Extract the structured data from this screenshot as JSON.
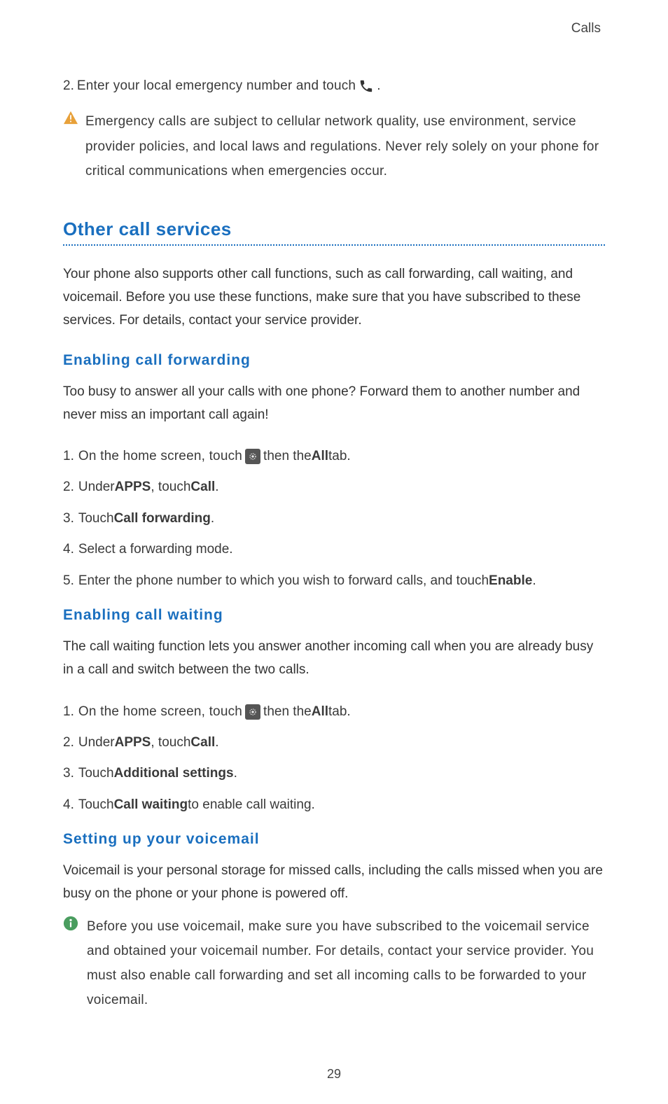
{
  "header": "Calls",
  "emergency": {
    "step_num": "2.",
    "step_text_before": "Enter your local emergency number and touch",
    "step_text_after": ".",
    "warning_text": "Emergency calls are subject to cellular network quality, use environment, service provider policies, and local laws and regulations. Never rely solely on your phone for critical communications when emergencies occur."
  },
  "section_heading": "Other call services",
  "intro_para": "Your phone also supports other call functions, such as call forwarding, call waiting, and voicemail. Before you use these functions, make sure that you have subscribed to these services. For details, contact your service provider.",
  "forwarding": {
    "heading": "Enabling call forwarding",
    "intro": "Too busy to answer all your calls with one phone? Forward them to another number and never miss an important call again!",
    "steps": {
      "s1_num": "1.",
      "s1_before": "On the home screen, touch",
      "s1_mid": "then the ",
      "s1_bold": "All",
      "s1_after": " tab.",
      "s2_num": "2.",
      "s2_before": "Under ",
      "s2_bold1": "APPS",
      "s2_mid": ", touch ",
      "s2_bold2": "Call",
      "s2_after": ".",
      "s3_num": "3.",
      "s3_before": "Touch ",
      "s3_bold": "Call forwarding",
      "s3_after": ".",
      "s4_num": "4.",
      "s4_text": "Select a forwarding mode.",
      "s5_num": "5.",
      "s5_before": "Enter the phone number to which you wish to forward calls, and touch ",
      "s5_bold": "Enable",
      "s5_after": "."
    }
  },
  "waiting": {
    "heading": "Enabling call waiting",
    "intro": "The call waiting function lets you answer another incoming call when you are already busy in a call and switch between the two calls.",
    "steps": {
      "s1_num": "1.",
      "s1_before": "On the home screen, touch",
      "s1_mid": "then the ",
      "s1_bold": "All",
      "s1_after": " tab.",
      "s2_num": "2.",
      "s2_before": "Under ",
      "s2_bold1": "APPS",
      "s2_mid": ", touch ",
      "s2_bold2": "Call",
      "s2_after": ".",
      "s3_num": "3.",
      "s3_before": "Touch ",
      "s3_bold": "Additional settings",
      "s3_after": ".",
      "s4_num": "4.",
      "s4_before": "Touch ",
      "s4_bold": "Call waiting",
      "s4_after": " to enable call waiting."
    }
  },
  "voicemail": {
    "heading": "Setting up your voicemail",
    "intro": "Voicemail is your personal storage for missed calls, including the calls missed when you are busy on the phone or your phone is powered off.",
    "info_text": "Before you use voicemail, make sure you have subscribed to the voicemail service and obtained your voicemail number. For details, contact your service provider. You must also enable call forwarding and set all incoming calls to be forwarded to your voicemail."
  },
  "page_number": "29"
}
